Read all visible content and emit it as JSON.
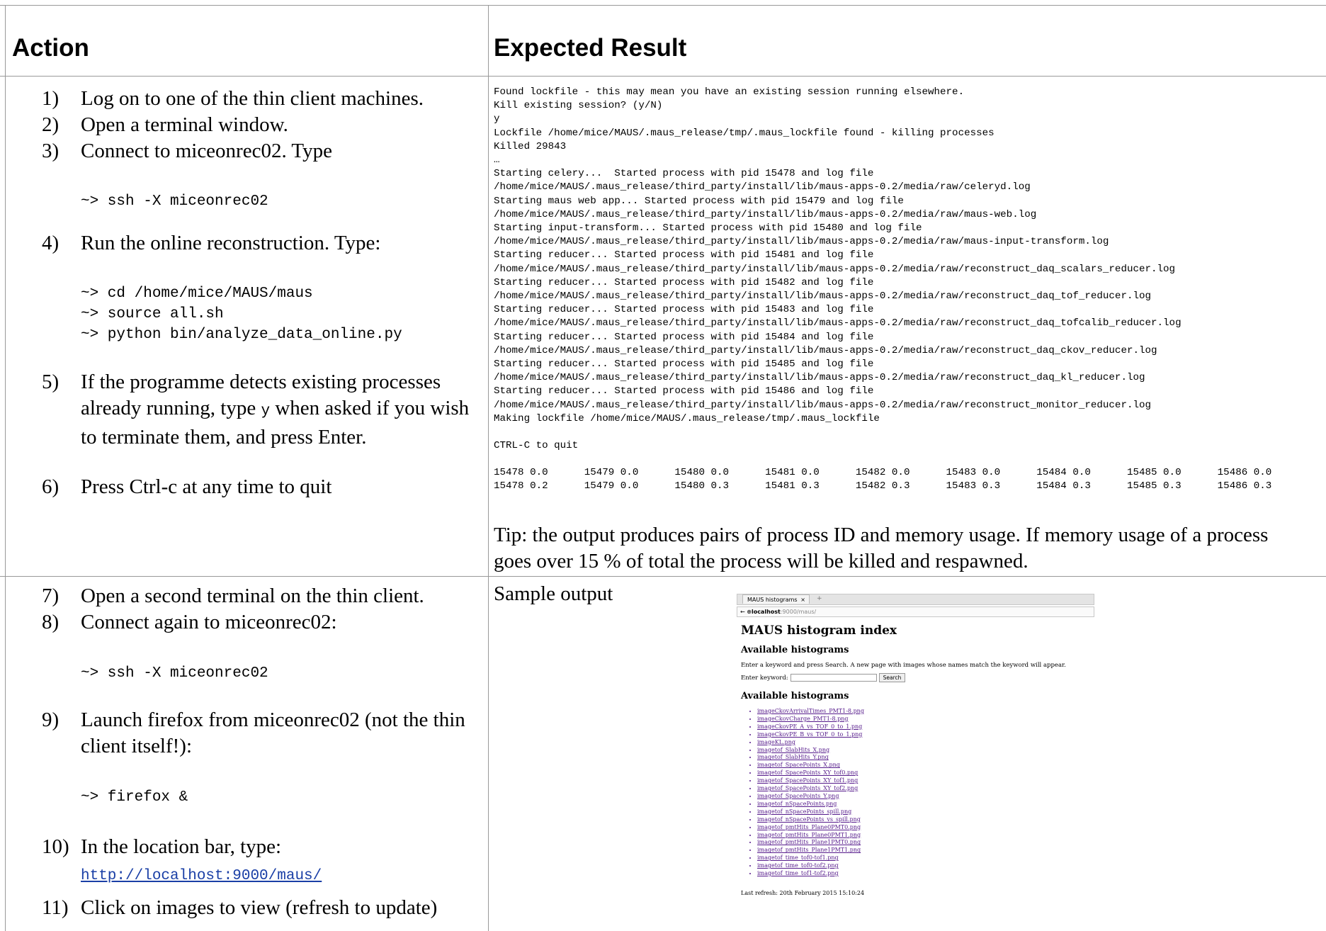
{
  "headers": {
    "action": "Action",
    "expected": "Expected Result"
  },
  "row1": {
    "steps": [
      {
        "num": "1)",
        "text": "Log on to one of the thin client machines."
      },
      {
        "num": "2)",
        "text": "Open a terminal window."
      },
      {
        "num": "3)",
        "text": "Connect to miceonrec02. Type"
      }
    ],
    "code1": "~> ssh -X miceonrec02",
    "step4": {
      "num": "4)",
      "text": "Run the online reconstruction. Type:"
    },
    "code2": "~> cd /home/mice/MAUS/maus\n~> source all.sh\n~> python bin/analyze_data_online.py",
    "step5": {
      "num": "5)",
      "text_before": "If the programme detects existing processes already running, type ",
      "code": "y",
      "text_after": " when asked if you wish to terminate them, and press Enter."
    },
    "step6": {
      "num": "6)",
      "text": "Press Ctrl-c at any time to quit"
    },
    "terminal_output": "Found lockfile - this may mean you have an existing session running elsewhere.\nKill existing session? (y/N)\ny\nLockfile /home/mice/MAUS/.maus_release/tmp/.maus_lockfile found - killing processes\nKilled 29843\n…\nStarting celery...  Started process with pid 15478 and log file\n/home/mice/MAUS/.maus_release/third_party/install/lib/maus-apps-0.2/media/raw/celeryd.log\nStarting maus web app... Started process with pid 15479 and log file\n/home/mice/MAUS/.maus_release/third_party/install/lib/maus-apps-0.2/media/raw/maus-web.log\nStarting input-transform... Started process with pid 15480 and log file\n/home/mice/MAUS/.maus_release/third_party/install/lib/maus-apps-0.2/media/raw/maus-input-transform.log\nStarting reducer... Started process with pid 15481 and log file\n/home/mice/MAUS/.maus_release/third_party/install/lib/maus-apps-0.2/media/raw/reconstruct_daq_scalars_reducer.log\nStarting reducer... Started process with pid 15482 and log file\n/home/mice/MAUS/.maus_release/third_party/install/lib/maus-apps-0.2/media/raw/reconstruct_daq_tof_reducer.log\nStarting reducer... Started process with pid 15483 and log file\n/home/mice/MAUS/.maus_release/third_party/install/lib/maus-apps-0.2/media/raw/reconstruct_daq_tofcalib_reducer.log\nStarting reducer... Started process with pid 15484 and log file\n/home/mice/MAUS/.maus_release/third_party/install/lib/maus-apps-0.2/media/raw/reconstruct_daq_ckov_reducer.log\nStarting reducer... Started process with pid 15485 and log file\n/home/mice/MAUS/.maus_release/third_party/install/lib/maus-apps-0.2/media/raw/reconstruct_daq_kl_reducer.log\nStarting reducer... Started process with pid 15486 and log file\n/home/mice/MAUS/.maus_release/third_party/install/lib/maus-apps-0.2/media/raw/reconstruct_monitor_reducer.log\nMaking lockfile /home/mice/MAUS/.maus_release/tmp/.maus_lockfile\n\nCTRL-C to quit",
    "memory_output": "15478 0.0      15479 0.0      15480 0.0      15481 0.0      15482 0.0      15483 0.0      15484 0.0      15485 0.0      15486 0.0\n15478 0.2      15479 0.0      15480 0.3      15481 0.3      15482 0.3      15483 0.3      15484 0.3      15485 0.3      15486 0.3",
    "tip": "Tip: the output produces pairs of process ID and memory usage. If memory usage of a process goes over 15 % of total the process will be killed and respawned."
  },
  "row2": {
    "steps_a": [
      {
        "num": "7)",
        "text": "Open a second terminal on the thin client."
      },
      {
        "num": "8)",
        "text": "Connect again to miceonrec02:"
      }
    ],
    "code3": "~> ssh -X miceonrec02",
    "step9": {
      "num": "9)",
      "text": "Launch firefox from miceonrec02 (not the thin client itself!):"
    },
    "code4": "~> firefox &",
    "step10": {
      "num": "10)",
      "text": "In the location bar, type:",
      "url": "http://localhost:9000/maus/"
    },
    "step11": {
      "num": "11)",
      "text": "Click on images to view (refresh to update)"
    },
    "sample_label": "Sample output",
    "browser": {
      "tab_title": "MAUS histograms",
      "tab_close": "×",
      "new_tab": "+",
      "url_host": "localhost",
      "url_path": ":9000/maus/",
      "page_title": "MAUS histogram index",
      "section1": "Available histograms",
      "instructions": "Enter a keyword and press Search. A new page with images whose names match the keyword will appear.",
      "keyword_label": "Enter keyword:",
      "keyword_value": "",
      "search_button": "Search",
      "section2": "Available histograms",
      "histograms": [
        "imageCkovArrivalTimes_PMT1-8.png",
        "imageCkovCharge_PMT1-8.png",
        "imageCkovPE_A_vs_TOF_0_to_1.png",
        "imageCkovPE_B_vs_TOF_0_to_1.png",
        "imageKL.png",
        "imagetof_SlabHits_X.png",
        "imagetof_SlabHits_Y.png",
        "imagetof_SpacePoints_X.png",
        "imagetof_SpacePoints_XY_tof0.png",
        "imagetof_SpacePoints_XY_tof1.png",
        "imagetof_SpacePoints_XY_tof2.png",
        "imagetof_SpacePoints_Y.png",
        "imagetof_nSpacePoints.png",
        "imagetof_nSpacePoints_spill.png",
        "imagetof_nSpacePoints_vs_spill.png",
        "imagetof_pmtHits_Plane0PMT0.png",
        "imagetof_pmtHits_Plane0PMT1.png",
        "imagetof_pmtHits_Plane1PMT0.png",
        "imagetof_pmtHits_Plane1PMT1.png",
        "imagetof_time_tof0-tof1.png",
        "imagetof_time_tof0-tof2.png",
        "imagetof_time_tof1-tof2.png"
      ],
      "last_refresh": "Last refresh: 20th February 2015 15:10:24"
    }
  }
}
